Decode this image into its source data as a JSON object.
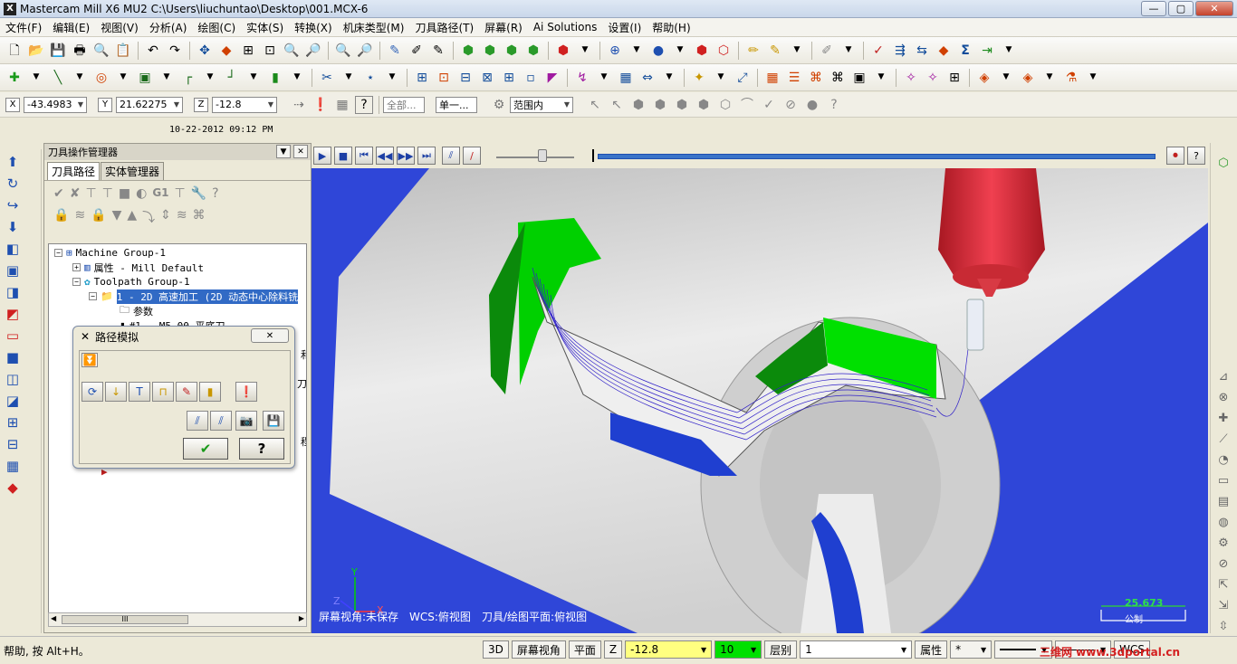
{
  "window": {
    "title": "Mastercam Mill X6 MU2  C:\\Users\\liuchuntao\\Desktop\\001.MCX-6",
    "btn_min": "—",
    "btn_max": "▢",
    "btn_close": "✕"
  },
  "menu": [
    "文件(F)",
    "编辑(E)",
    "视图(V)",
    "分析(A)",
    "绘图(C)",
    "实体(S)",
    "转换(X)",
    "机床类型(M)",
    "刀具路径(T)",
    "屏幕(R)",
    "Ai Solutions",
    "设置(I)",
    "帮助(H)"
  ],
  "coords": {
    "x_label": "X",
    "x_value": "-43.4983",
    "y_label": "Y",
    "y_value": "21.62275",
    "z_label": "Z",
    "z_value": "-12.8",
    "filter_all": "全部...",
    "filter_single": "单一...",
    "range_label": "范围内"
  },
  "datetime": "10-22-2012  09:12 PM",
  "manager": {
    "title": "刀具操作管理器",
    "tabs": [
      "刀具路径",
      "实体管理器"
    ],
    "tree": {
      "machine_group": "Machine Group-1",
      "properties": "属性 - Mill Default",
      "toolpath_group": "Toolpath Group-1",
      "operation": "1 - 2D 高速加工 (2D 动态中心除料铣",
      "params": "参数",
      "tool": "#1 - M5.00 平底刀 -",
      "clip_1": "和",
      "clip_2": "刀",
      "clip_3": "程"
    },
    "scroll_grip": "III"
  },
  "sim_dialog": {
    "title": "路径模拟",
    "close": "✕",
    "ok": "✔",
    "help": "?"
  },
  "viewport": {
    "status_view": "屏幕视角:未保存",
    "status_wcs": "WCS:俯视图",
    "status_plane": "刀具/绘图平面:俯视图",
    "scale_value": "25.673",
    "scale_unit": "公制",
    "axis_y": "Y",
    "axis_z": "Z",
    "axis_x": "X"
  },
  "status": {
    "help": "帮助, 按 Alt+H。",
    "btn_3d": "3D",
    "btn_view": "屏幕视角",
    "btn_plane": "平面",
    "z_label": "Z",
    "z_value": "-12.8",
    "color_value": "10",
    "layer_label": "层别",
    "layer_value": "1",
    "attr_label": "属性",
    "point_style": "*",
    "wcs_label": "WCS",
    "watermark": "三维网 www.3dportal.cn"
  },
  "colors": {
    "viewport_bg": "#2f46d8",
    "part_gray": "#d8d8d8",
    "cut_green": "#00e000",
    "spindle_red": "#e0303c",
    "highlight": "#316ac5"
  }
}
